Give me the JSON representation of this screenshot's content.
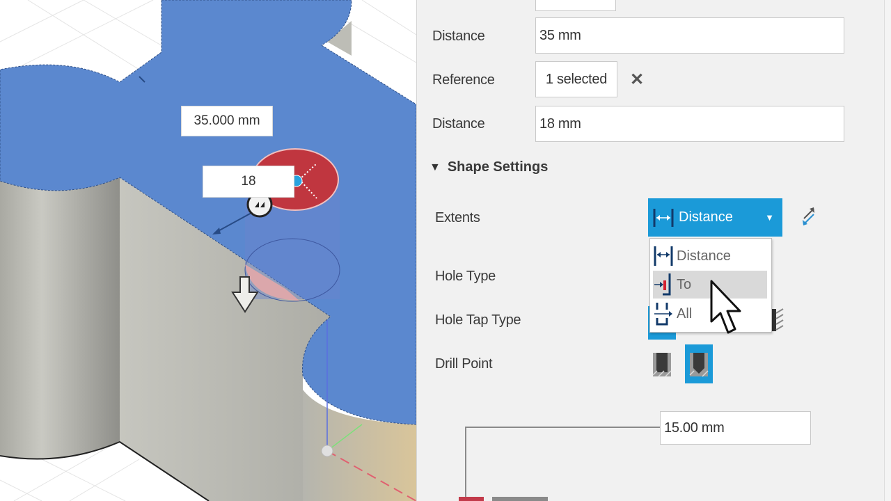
{
  "viewport": {
    "dimension_label": "35.000 mm",
    "diameter_label": "18",
    "colors": {
      "selected_face": "#5b88cf",
      "wall": "#b9b9b0",
      "hole_marker": "#c0363f",
      "background": "#ffffff"
    }
  },
  "panel": {
    "rows": [
      {
        "label": "Distance",
        "value": "35 mm"
      },
      {
        "label": "Reference",
        "value": "1 selected",
        "clear_icon": "close-icon"
      },
      {
        "label": "Distance",
        "value": "18 mm"
      }
    ],
    "shape_settings": {
      "title": "Shape Settings",
      "expanded": true,
      "extents": {
        "label": "Extents",
        "selected": "Distance",
        "options": [
          {
            "label": "Distance",
            "icon": "distance-extent-icon"
          },
          {
            "label": "To",
            "icon": "to-extent-icon",
            "hovered": true
          },
          {
            "label": "All",
            "icon": "all-extent-icon"
          }
        ],
        "flip_icon": "flip-direction-icon"
      },
      "hole_type": {
        "label": "Hole Type"
      },
      "hole_tap_type": {
        "label": "Hole Tap Type"
      },
      "drill_point": {
        "label": "Drill Point",
        "options": [
          {
            "name": "flat-drill-point-icon",
            "active": false
          },
          {
            "name": "angled-drill-point-icon",
            "active": true
          }
        ]
      },
      "depth_value": "15.00 mm"
    },
    "accent_color": "#1b9ad8"
  }
}
